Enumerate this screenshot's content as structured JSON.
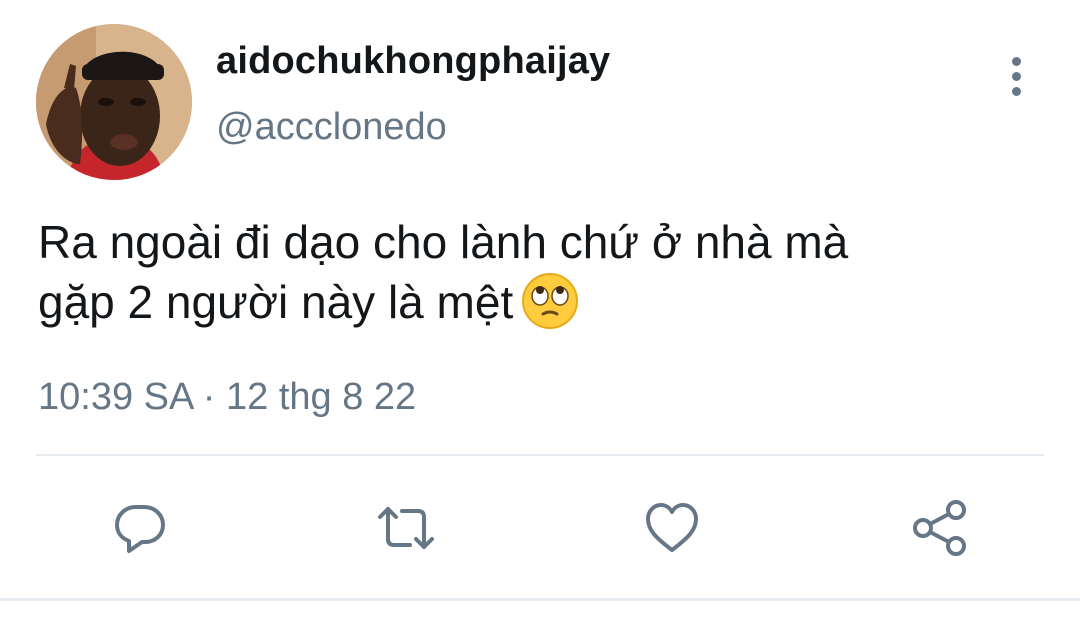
{
  "user": {
    "display_name": "aidochukhongphaijay",
    "handle": "@accclonedo",
    "avatar_icon": "profile-photo"
  },
  "tweet": {
    "text_line1": "Ra ngoài đi dạo cho lành chứ ở nhà mà",
    "text_line2": "gặp 2 người này là mệt",
    "emoji": "face-with-rolling-eyes",
    "time": "10:39 SA · 12 thg 8 22"
  },
  "actions": {
    "reply_icon": "reply-icon",
    "retweet_icon": "retweet-icon",
    "like_icon": "heart-icon",
    "share_icon": "share-icon",
    "more_icon": "more-vertical-icon"
  },
  "colors": {
    "text": "#14171a",
    "secondary": "#657786",
    "icon": "#657786",
    "divider": "#e6ecf0"
  }
}
